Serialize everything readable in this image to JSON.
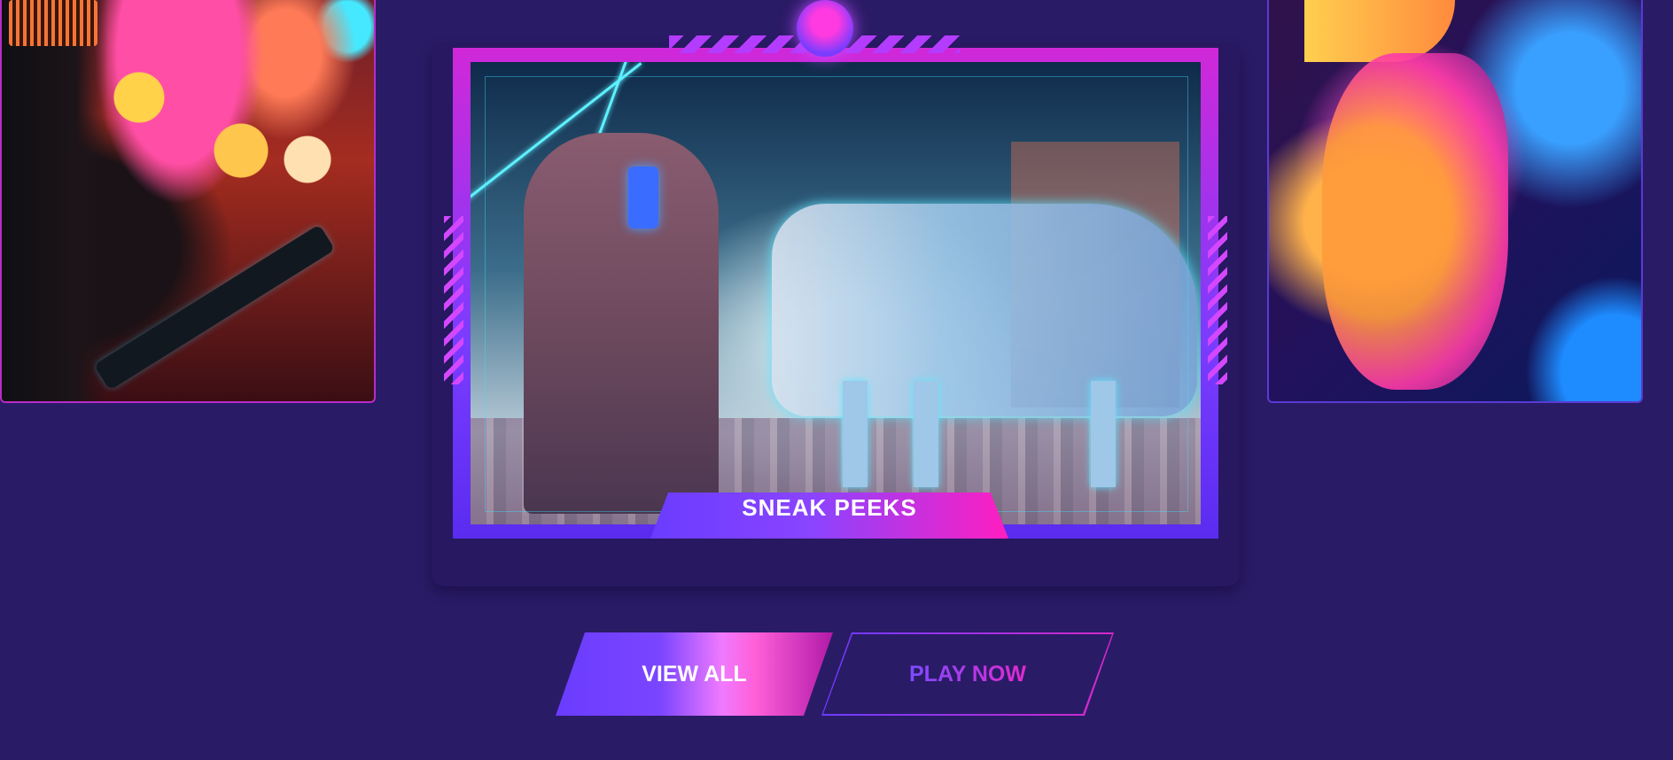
{
  "carousel": {
    "active_slide": {
      "label": "SNEAK PEEKS"
    }
  },
  "actions": {
    "view_all_label": "VIEW ALL",
    "play_now_label": "PLAY NOW"
  },
  "colors": {
    "background": "#2a1b66",
    "accent_purple": "#6a3cff",
    "accent_pink": "#ff1ec0"
  },
  "icons": {
    "frame_ornament": "orb-icon"
  }
}
